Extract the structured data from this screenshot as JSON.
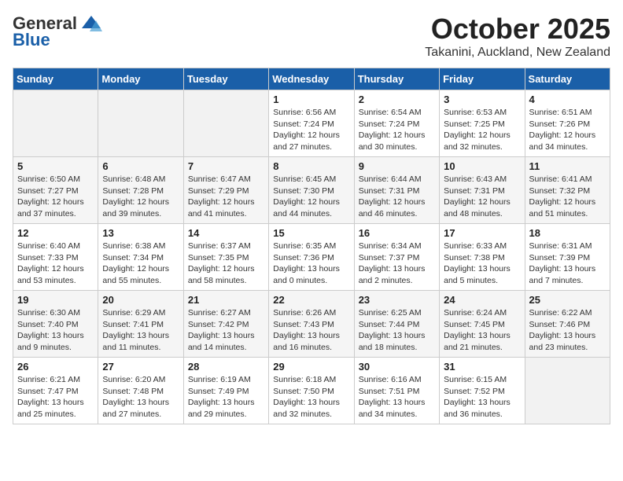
{
  "header": {
    "logo_general": "General",
    "logo_blue": "Blue",
    "month": "October 2025",
    "location": "Takanini, Auckland, New Zealand"
  },
  "weekdays": [
    "Sunday",
    "Monday",
    "Tuesday",
    "Wednesday",
    "Thursday",
    "Friday",
    "Saturday"
  ],
  "weeks": [
    [
      {
        "day": "",
        "info": ""
      },
      {
        "day": "",
        "info": ""
      },
      {
        "day": "",
        "info": ""
      },
      {
        "day": "1",
        "info": "Sunrise: 6:56 AM\nSunset: 7:24 PM\nDaylight: 12 hours\nand 27 minutes."
      },
      {
        "day": "2",
        "info": "Sunrise: 6:54 AM\nSunset: 7:24 PM\nDaylight: 12 hours\nand 30 minutes."
      },
      {
        "day": "3",
        "info": "Sunrise: 6:53 AM\nSunset: 7:25 PM\nDaylight: 12 hours\nand 32 minutes."
      },
      {
        "day": "4",
        "info": "Sunrise: 6:51 AM\nSunset: 7:26 PM\nDaylight: 12 hours\nand 34 minutes."
      }
    ],
    [
      {
        "day": "5",
        "info": "Sunrise: 6:50 AM\nSunset: 7:27 PM\nDaylight: 12 hours\nand 37 minutes."
      },
      {
        "day": "6",
        "info": "Sunrise: 6:48 AM\nSunset: 7:28 PM\nDaylight: 12 hours\nand 39 minutes."
      },
      {
        "day": "7",
        "info": "Sunrise: 6:47 AM\nSunset: 7:29 PM\nDaylight: 12 hours\nand 41 minutes."
      },
      {
        "day": "8",
        "info": "Sunrise: 6:45 AM\nSunset: 7:30 PM\nDaylight: 12 hours\nand 44 minutes."
      },
      {
        "day": "9",
        "info": "Sunrise: 6:44 AM\nSunset: 7:31 PM\nDaylight: 12 hours\nand 46 minutes."
      },
      {
        "day": "10",
        "info": "Sunrise: 6:43 AM\nSunset: 7:31 PM\nDaylight: 12 hours\nand 48 minutes."
      },
      {
        "day": "11",
        "info": "Sunrise: 6:41 AM\nSunset: 7:32 PM\nDaylight: 12 hours\nand 51 minutes."
      }
    ],
    [
      {
        "day": "12",
        "info": "Sunrise: 6:40 AM\nSunset: 7:33 PM\nDaylight: 12 hours\nand 53 minutes."
      },
      {
        "day": "13",
        "info": "Sunrise: 6:38 AM\nSunset: 7:34 PM\nDaylight: 12 hours\nand 55 minutes."
      },
      {
        "day": "14",
        "info": "Sunrise: 6:37 AM\nSunset: 7:35 PM\nDaylight: 12 hours\nand 58 minutes."
      },
      {
        "day": "15",
        "info": "Sunrise: 6:35 AM\nSunset: 7:36 PM\nDaylight: 13 hours\nand 0 minutes."
      },
      {
        "day": "16",
        "info": "Sunrise: 6:34 AM\nSunset: 7:37 PM\nDaylight: 13 hours\nand 2 minutes."
      },
      {
        "day": "17",
        "info": "Sunrise: 6:33 AM\nSunset: 7:38 PM\nDaylight: 13 hours\nand 5 minutes."
      },
      {
        "day": "18",
        "info": "Sunrise: 6:31 AM\nSunset: 7:39 PM\nDaylight: 13 hours\nand 7 minutes."
      }
    ],
    [
      {
        "day": "19",
        "info": "Sunrise: 6:30 AM\nSunset: 7:40 PM\nDaylight: 13 hours\nand 9 minutes."
      },
      {
        "day": "20",
        "info": "Sunrise: 6:29 AM\nSunset: 7:41 PM\nDaylight: 13 hours\nand 11 minutes."
      },
      {
        "day": "21",
        "info": "Sunrise: 6:27 AM\nSunset: 7:42 PM\nDaylight: 13 hours\nand 14 minutes."
      },
      {
        "day": "22",
        "info": "Sunrise: 6:26 AM\nSunset: 7:43 PM\nDaylight: 13 hours\nand 16 minutes."
      },
      {
        "day": "23",
        "info": "Sunrise: 6:25 AM\nSunset: 7:44 PM\nDaylight: 13 hours\nand 18 minutes."
      },
      {
        "day": "24",
        "info": "Sunrise: 6:24 AM\nSunset: 7:45 PM\nDaylight: 13 hours\nand 21 minutes."
      },
      {
        "day": "25",
        "info": "Sunrise: 6:22 AM\nSunset: 7:46 PM\nDaylight: 13 hours\nand 23 minutes."
      }
    ],
    [
      {
        "day": "26",
        "info": "Sunrise: 6:21 AM\nSunset: 7:47 PM\nDaylight: 13 hours\nand 25 minutes."
      },
      {
        "day": "27",
        "info": "Sunrise: 6:20 AM\nSunset: 7:48 PM\nDaylight: 13 hours\nand 27 minutes."
      },
      {
        "day": "28",
        "info": "Sunrise: 6:19 AM\nSunset: 7:49 PM\nDaylight: 13 hours\nand 29 minutes."
      },
      {
        "day": "29",
        "info": "Sunrise: 6:18 AM\nSunset: 7:50 PM\nDaylight: 13 hours\nand 32 minutes."
      },
      {
        "day": "30",
        "info": "Sunrise: 6:16 AM\nSunset: 7:51 PM\nDaylight: 13 hours\nand 34 minutes."
      },
      {
        "day": "31",
        "info": "Sunrise: 6:15 AM\nSunset: 7:52 PM\nDaylight: 13 hours\nand 36 minutes."
      },
      {
        "day": "",
        "info": ""
      }
    ]
  ]
}
